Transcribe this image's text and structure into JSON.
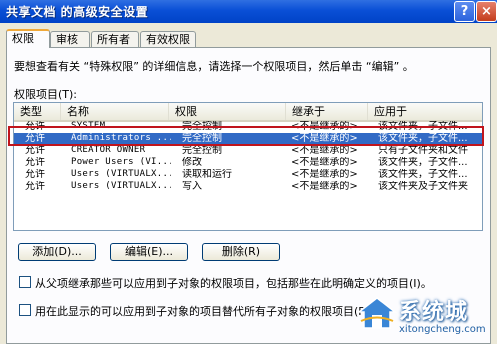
{
  "window": {
    "title": "共享文档 的高级安全设置",
    "help_label": "?",
    "close_label": "×"
  },
  "tabs": [
    {
      "label": "权限",
      "active": true
    },
    {
      "label": "审核",
      "active": false
    },
    {
      "label": "所有者",
      "active": false
    },
    {
      "label": "有效权限",
      "active": false
    }
  ],
  "instruction": "要想查看有关 “特殊权限” 的详细信息，请选择一个权限项目，然后单击 “编辑” 。",
  "list_label": "权限项目(T):",
  "columns": [
    "类型",
    "名称",
    "权限",
    "继承于",
    "应用于"
  ],
  "rows": [
    {
      "type": "允许",
      "name": "SYSTEM",
      "permission": "完全控制",
      "inherited": "<不是继承的>",
      "applies": "该文件夹，子文件..."
    },
    {
      "type": "允许",
      "name": "Administrators ...",
      "permission": "完全控制",
      "inherited": "<不是继承的>",
      "applies": "该文件夹，子文件..."
    },
    {
      "type": "允许",
      "name": "CREATOR OWNER",
      "permission": "完全控制",
      "inherited": "<不是继承的>",
      "applies": "只有子文件夹和文件"
    },
    {
      "type": "允许",
      "name": "Power Users (VI...",
      "permission": "修改",
      "inherited": "<不是继承的>",
      "applies": "该文件夹，子文件..."
    },
    {
      "type": "允许",
      "name": "Users (VIRTUALX...",
      "permission": "读取和运行",
      "inherited": "<不是继承的>",
      "applies": "该文件夹，子文件..."
    },
    {
      "type": "允许",
      "name": "Users (VIRTUALX...",
      "permission": "写入",
      "inherited": "<不是继承的>",
      "applies": "该文件夹及子文件夹"
    }
  ],
  "selected_row": 1,
  "buttons": {
    "add": "添加(D)...",
    "edit": "编辑(E)...",
    "remove": "删除(R)"
  },
  "checkboxes": [
    {
      "label": "从父项继承那些可以应用到子对象的权限项目，包括那些在此明确定义的项目(I)。",
      "checked": false
    },
    {
      "label": "用在此显示的可以应用到子对象的项目替代所有子对象的权限项目(P)",
      "checked": false
    }
  ],
  "watermark": {
    "name": "系统城",
    "url": "xitongcheng.com"
  },
  "colors": {
    "title_bar": "#0a4fd6",
    "selection": "#316ac5",
    "highlight_box": "#c0141c",
    "dialog_bg": "#ece9d8"
  }
}
